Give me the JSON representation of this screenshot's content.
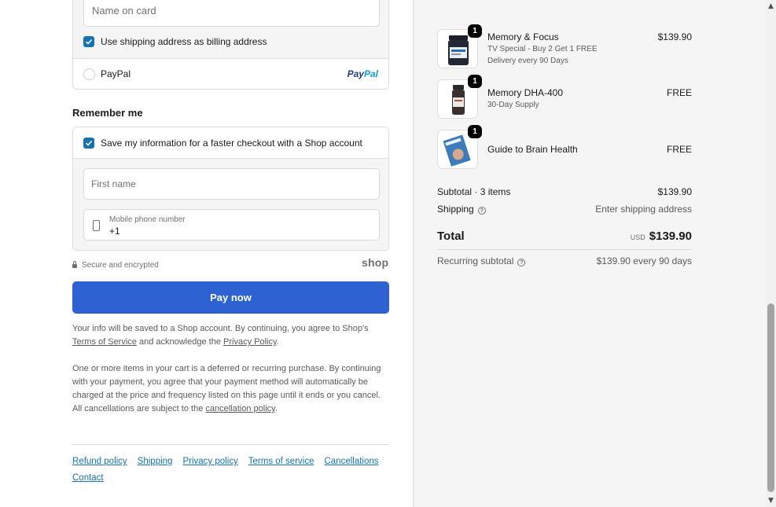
{
  "payment": {
    "name_on_card_placeholder": "Name on card",
    "billing_label": "Use shipping address as billing address",
    "paypal_label": "PayPal",
    "paypal_logo_part1": "Pay",
    "paypal_logo_part2": "Pal"
  },
  "remember": {
    "title": "Remember me",
    "save_label": "Save my information for a faster checkout with a Shop account",
    "first_name_placeholder": "First name",
    "phone_label": "Mobile phone number",
    "phone_value": "+1"
  },
  "secure_text": "Secure and encrypted",
  "shop_logo": "shop",
  "pay_button": "Pay now",
  "legal": {
    "p1_before": "Your info will be saved to a Shop account. By continuing, you agree to Shop's ",
    "p1_terms": "Terms of Service",
    "p1_mid": " and acknowledge the ",
    "p1_privacy": "Privacy Policy",
    "p1_end": ".",
    "p2_before": "One or more items in your cart is a deferred or recurring purchase. By continuing with your payment, you agree that your payment method will automatically be charged at the price and frequency listed on this page until it ends or you cancel. All cancellations are subject to the ",
    "p2_link": "cancellation policy",
    "p2_end": "."
  },
  "footer_links": [
    "Refund policy",
    "Shipping",
    "Privacy policy",
    "Terms of service",
    "Cancellations",
    "Contact"
  ],
  "order": {
    "items": [
      {
        "name": "Memory & Focus",
        "qty": "1",
        "subs": [
          "TV Special - Buy 2 Get 1 FREE",
          "Delivery every 90 Days"
        ],
        "price": "$139.90"
      },
      {
        "name": "Memory DHA-400",
        "qty": "1",
        "subs": [
          "30-Day Supply"
        ],
        "price": "FREE"
      },
      {
        "name": "Guide to Brain Health",
        "qty": "1",
        "subs": [],
        "price": "FREE"
      }
    ],
    "subtotal_label": "Subtotal · 3 items",
    "subtotal_value": "$139.90",
    "shipping_label": "Shipping",
    "shipping_value": "Enter shipping address",
    "total_label": "Total",
    "currency": "USD",
    "total_value": "$139.90",
    "recurring_label": "Recurring subtotal",
    "recurring_value": "$139.90 every 90 days"
  },
  "colors": {
    "accent": "#1773b0",
    "pay_button": "#2e62d3",
    "summary_bg": "#f5f5f5"
  }
}
